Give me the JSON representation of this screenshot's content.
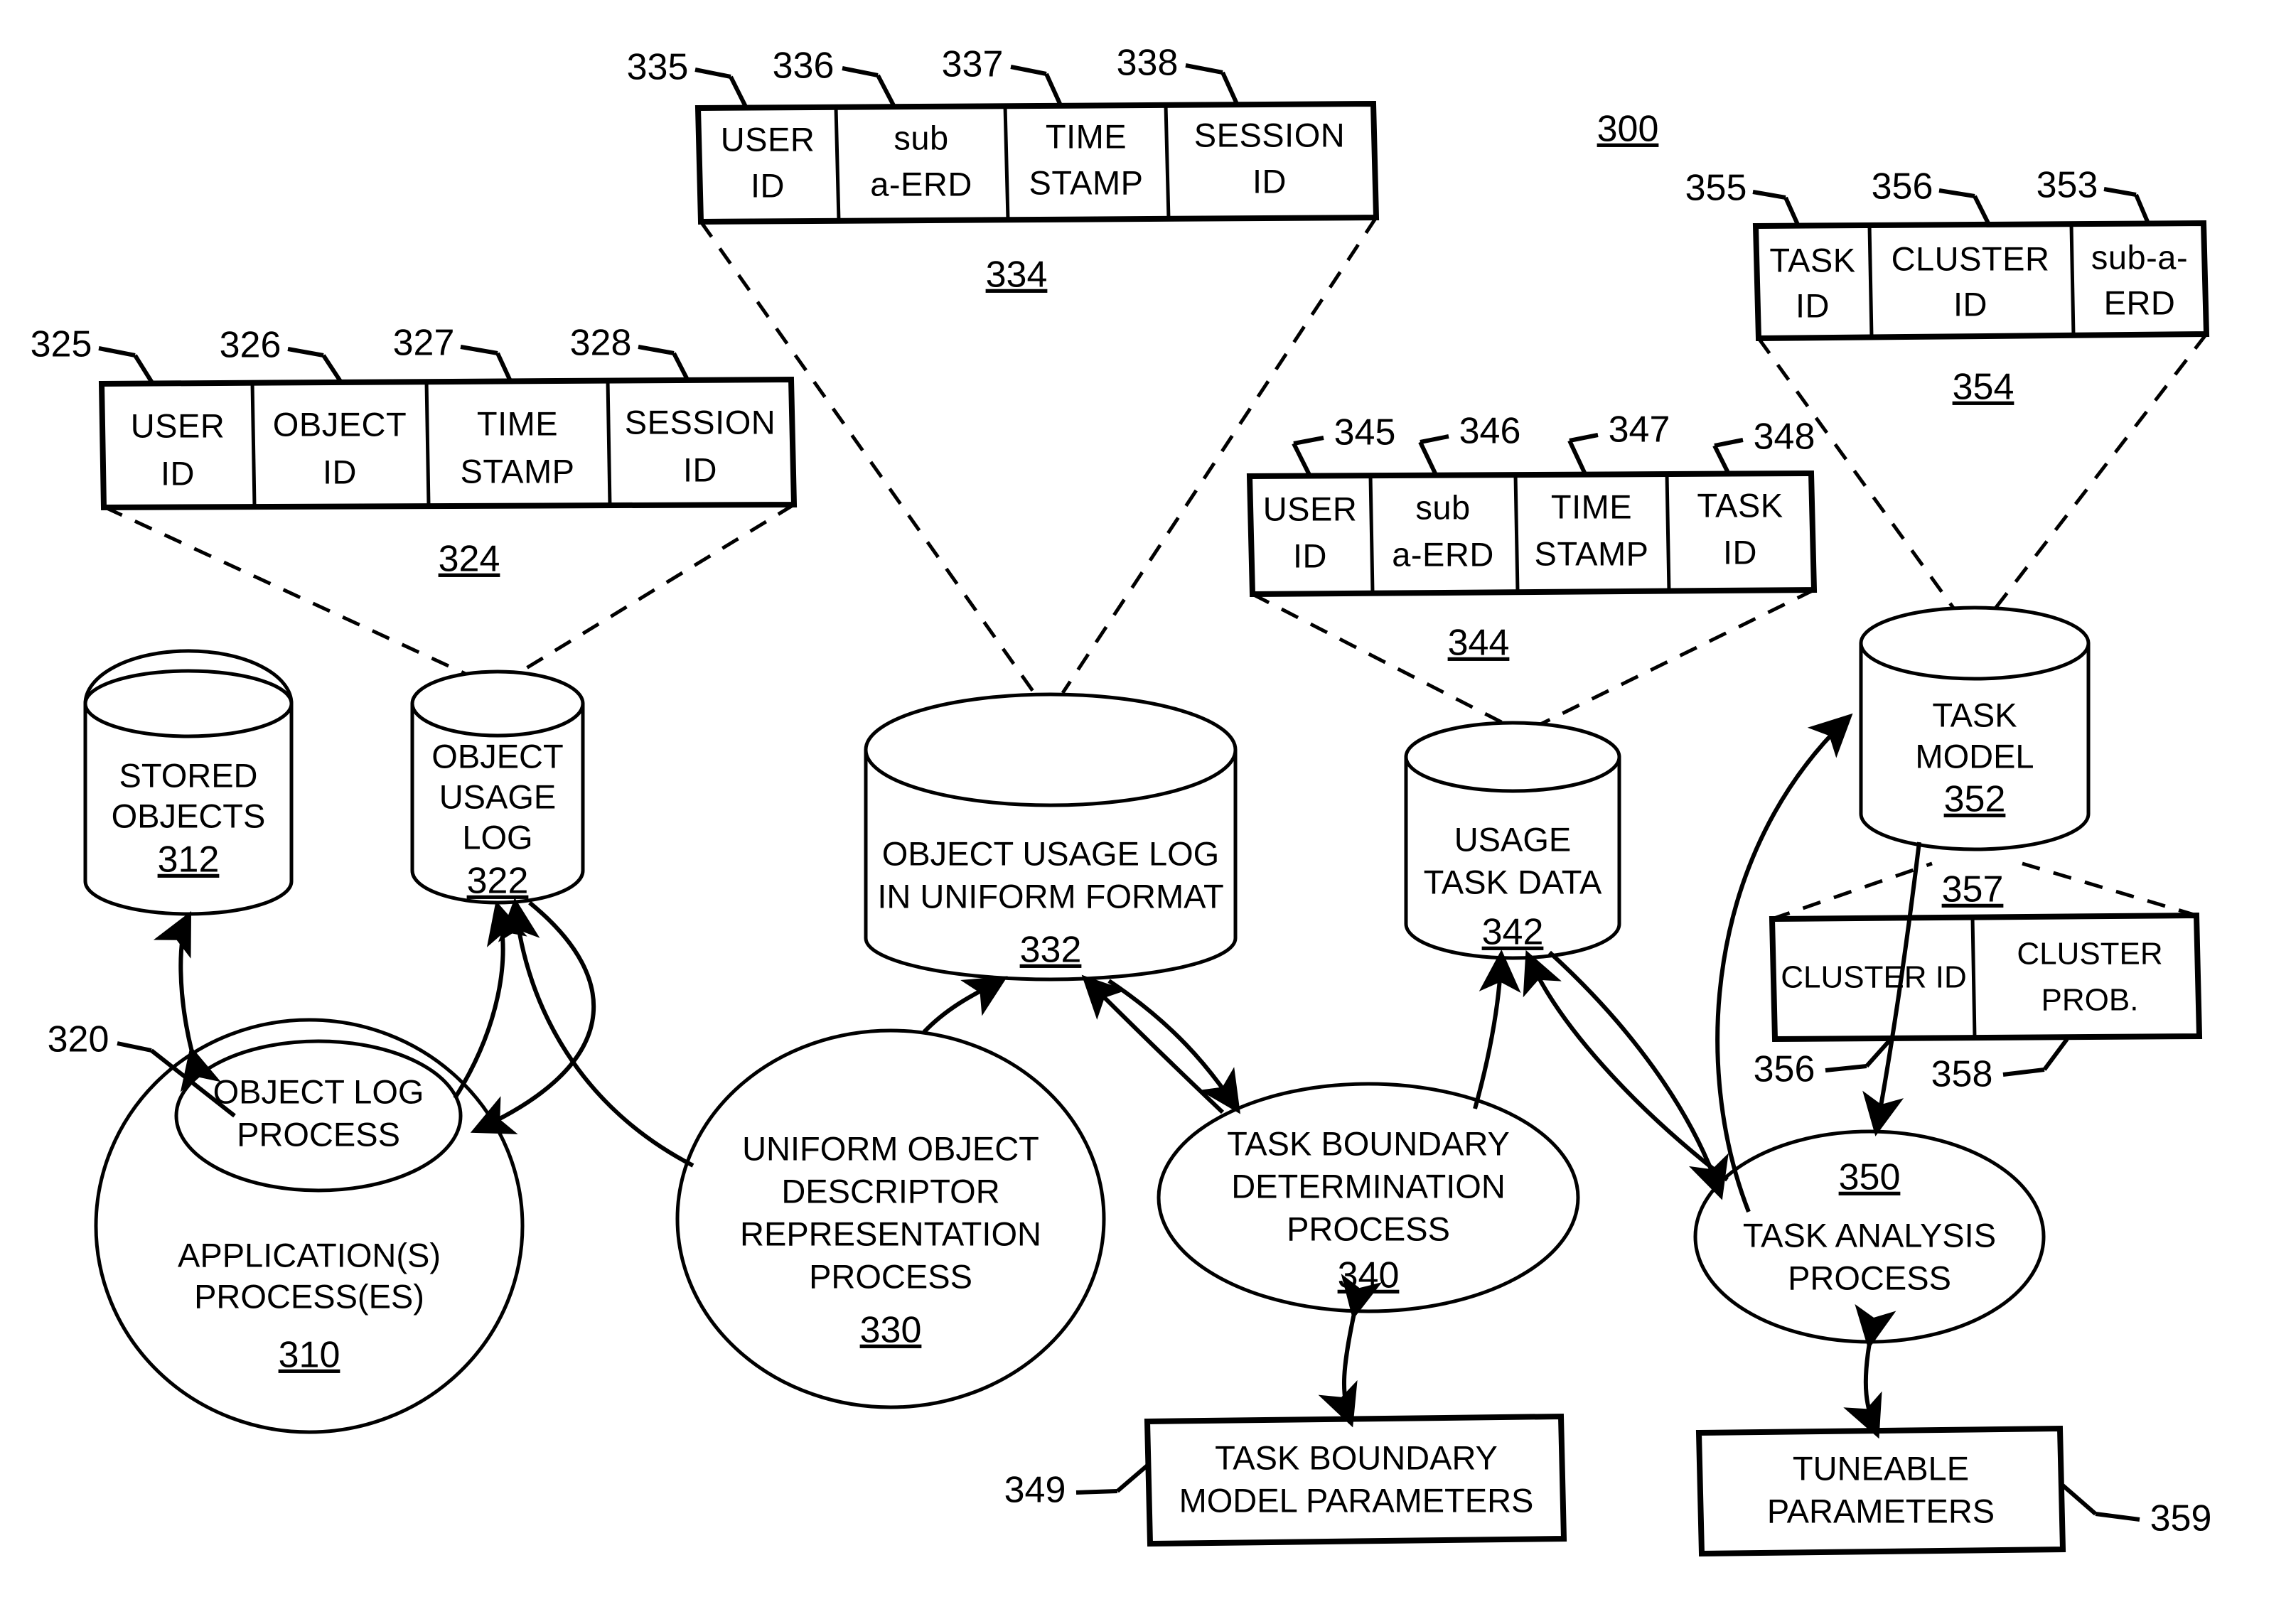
{
  "figure": {
    "number": "300"
  },
  "tables": [
    {
      "id": "table-324",
      "ref": "324",
      "cells": [
        {
          "ref": "325",
          "line1": "USER",
          "line2": "ID"
        },
        {
          "ref": "326",
          "line1": "OBJECT",
          "line2": "ID"
        },
        {
          "ref": "327",
          "line1": "TIME",
          "line2": "STAMP"
        },
        {
          "ref": "328",
          "line1": "SESSION",
          "line2": "ID"
        }
      ]
    },
    {
      "id": "table-334",
      "ref": "334",
      "cells": [
        {
          "ref": "335",
          "line1": "USER",
          "line2": "ID"
        },
        {
          "ref": "336",
          "line1": "sub",
          "line2": "a-ERD"
        },
        {
          "ref": "337",
          "line1": "TIME",
          "line2": "STAMP"
        },
        {
          "ref": "338",
          "line1": "SESSION",
          "line2": "ID"
        }
      ]
    },
    {
      "id": "table-344",
      "ref": "344",
      "cells": [
        {
          "ref": "345",
          "line1": "USER",
          "line2": "ID"
        },
        {
          "ref": "346",
          "line1": "sub",
          "line2": "a-ERD"
        },
        {
          "ref": "347",
          "line1": "TIME",
          "line2": "STAMP"
        },
        {
          "ref": "348",
          "line1": "TASK",
          "line2": "ID"
        }
      ]
    },
    {
      "id": "table-354",
      "ref": "354",
      "cells": [
        {
          "ref": "355",
          "line1": "TASK",
          "line2": "ID"
        },
        {
          "ref": "356",
          "line1": "CLUSTER",
          "line2": "ID"
        },
        {
          "ref": "353",
          "line1": "sub-a-",
          "line2": "ERD"
        }
      ]
    },
    {
      "id": "table-357",
      "ref": "357",
      "cells": [
        {
          "ref": "356",
          "line1": "CLUSTER ID",
          "line2": ""
        },
        {
          "ref": "358",
          "line1": "CLUSTER",
          "line2": "PROB."
        }
      ]
    }
  ],
  "datastores": [
    {
      "id": "stored-objects",
      "ref": "312",
      "lines": [
        "STORED",
        "OBJECTS"
      ]
    },
    {
      "id": "object-usage-log",
      "ref": "322",
      "lines": [
        "OBJECT",
        "USAGE",
        "LOG"
      ]
    },
    {
      "id": "uniform-log",
      "ref": "332",
      "lines": [
        "OBJECT USAGE LOG",
        "IN UNIFORM FORMAT"
      ]
    },
    {
      "id": "usage-task-data",
      "ref": "342",
      "lines": [
        "USAGE",
        "TASK DATA"
      ]
    },
    {
      "id": "task-model",
      "ref": "352",
      "lines": [
        "TASK",
        "MODEL"
      ]
    }
  ],
  "processes": [
    {
      "id": "application-processes",
      "ref": "310",
      "lines": [
        "APPLICATION(S)",
        "PROCESS(ES)"
      ]
    },
    {
      "id": "object-log-process",
      "ref": "320",
      "lines": [
        "OBJECT LOG",
        "PROCESS"
      ]
    },
    {
      "id": "uniform-object-process",
      "ref": "330",
      "lines": [
        "UNIFORM OBJECT",
        "DESCRIPTOR",
        "REPRESENTATION",
        "PROCESS"
      ]
    },
    {
      "id": "task-boundary-process",
      "ref": "340",
      "lines": [
        "TASK BOUNDARY",
        "DETERMINATION",
        "PROCESS"
      ]
    },
    {
      "id": "task-analysis-process",
      "ref": "350",
      "lines": [
        "TASK ANALYSIS",
        "PROCESS"
      ]
    }
  ],
  "parameter_boxes": [
    {
      "id": "task-boundary-model-parameters",
      "ref": "349",
      "lines": [
        "TASK BOUNDARY",
        "MODEL PARAMETERS"
      ]
    },
    {
      "id": "tuneable-parameters",
      "ref": "359",
      "lines": [
        "TUNEABLE",
        "PARAMETERS"
      ]
    }
  ],
  "colors": {
    "ink": "#000000",
    "paper": "#ffffff"
  }
}
